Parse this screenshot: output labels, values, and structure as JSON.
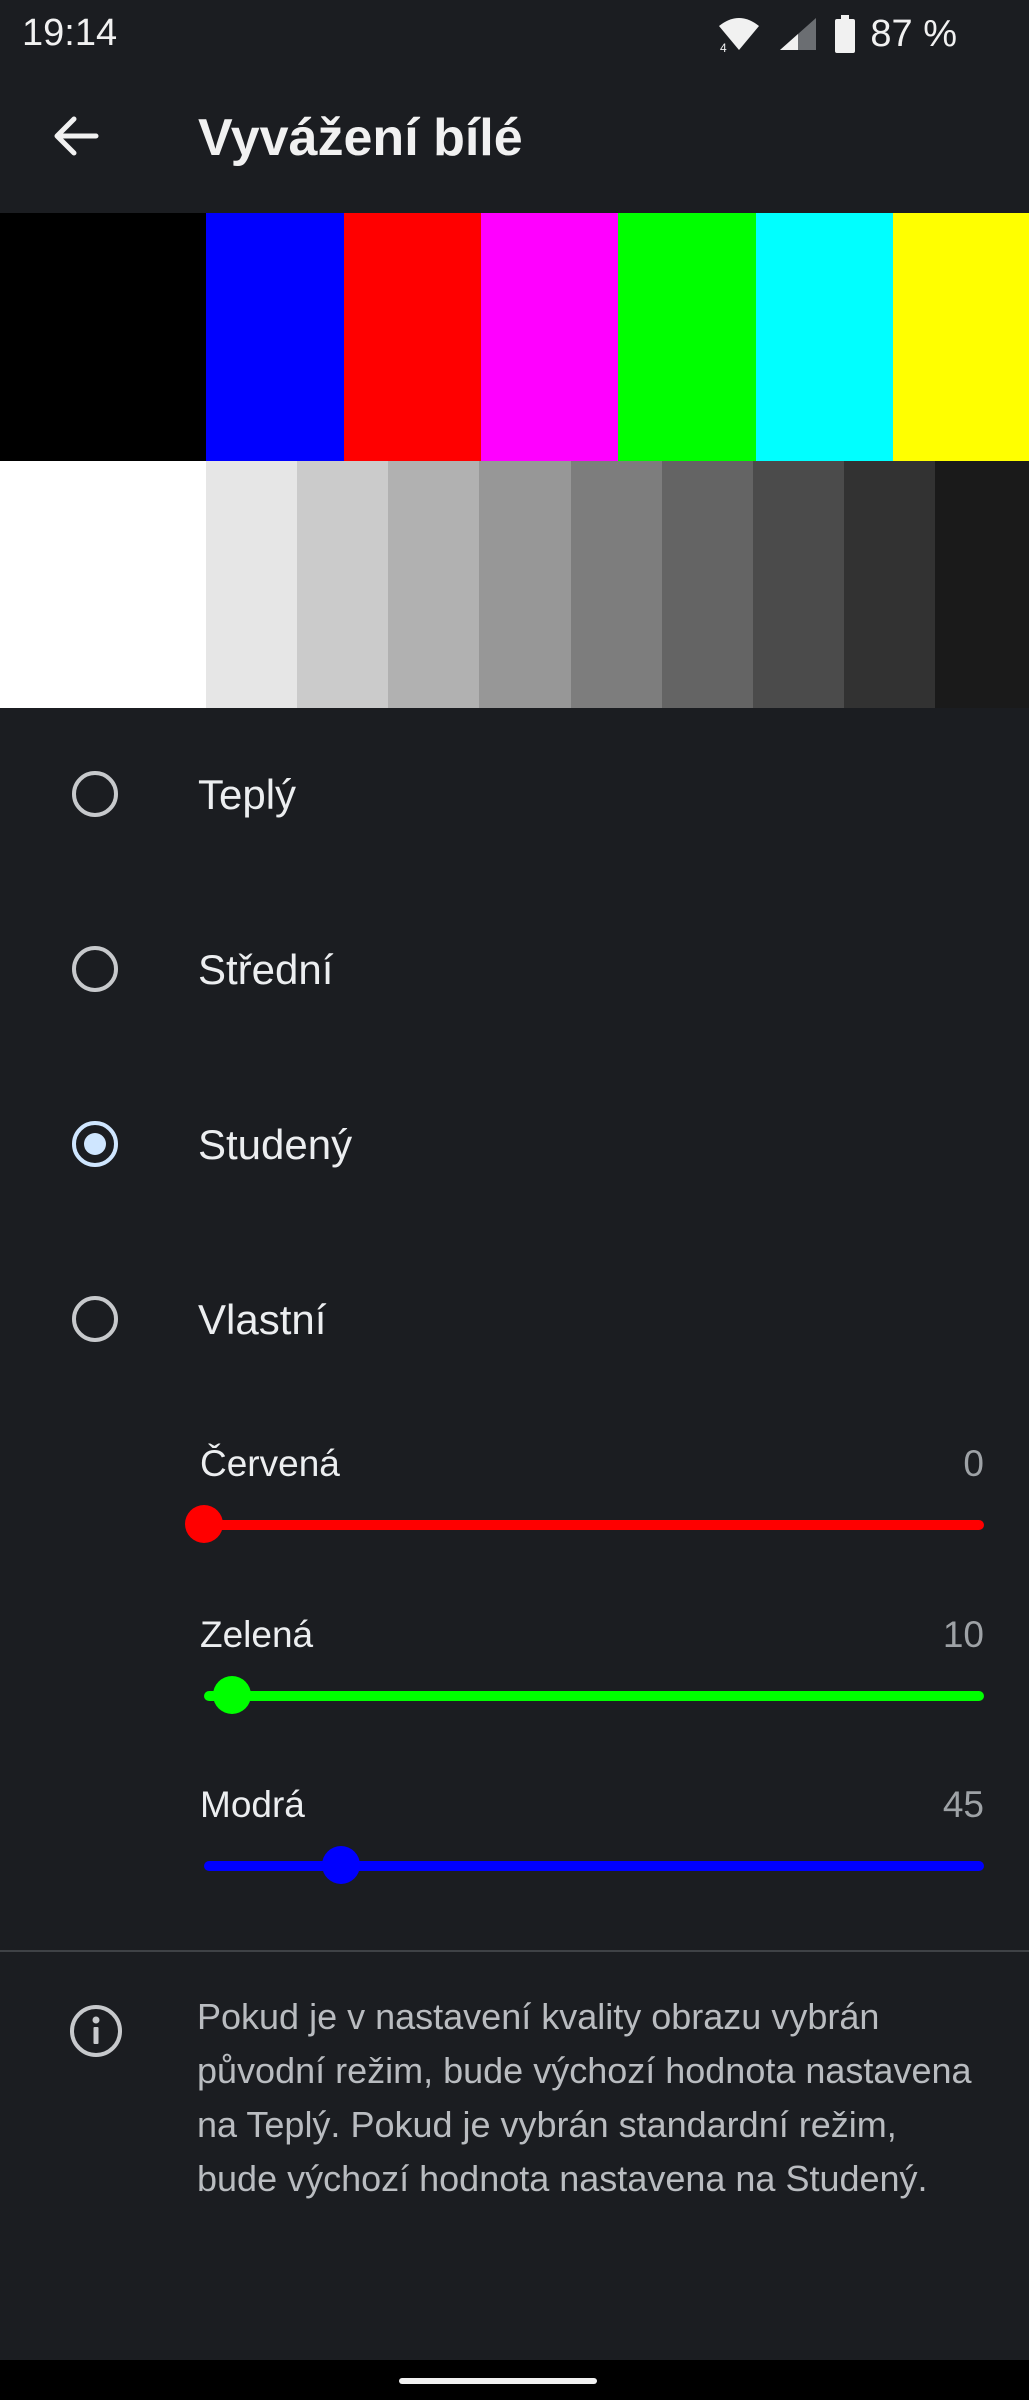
{
  "status_bar": {
    "time": "19:14",
    "battery": "87 %",
    "icons": [
      "wifi-icon",
      "signal-icon",
      "battery-icon"
    ]
  },
  "header": {
    "back_icon": "arrow-left-icon",
    "title": "Vyvážení bílé"
  },
  "color_bars": {
    "top": [
      "#000000",
      "#0000ff",
      "#ff0000",
      "#ff00ff",
      "#00ff00",
      "#00ffff",
      "#ffff00"
    ],
    "bottom": [
      "#ffffff",
      "#e6e6e6",
      "#cbcbcb",
      "#b1b1b1",
      "#979797",
      "#7d7d7d",
      "#646464",
      "#4b4b4b",
      "#323232",
      "#1a1a1a"
    ]
  },
  "options": [
    {
      "label": "Teplý",
      "selected": false
    },
    {
      "label": "Střední",
      "selected": false
    },
    {
      "label": "Studený",
      "selected": true
    },
    {
      "label": "Vlastní",
      "selected": false
    }
  ],
  "sliders": [
    {
      "label": "Červená",
      "value": "0",
      "fraction": 0.0,
      "color": "#ff0000"
    },
    {
      "label": "Zelená",
      "value": "10",
      "fraction": 0.036,
      "color": "#00ff00"
    },
    {
      "label": "Modrá",
      "value": "45",
      "fraction": 0.175,
      "color": "#0000ff"
    }
  ],
  "info": {
    "icon": "info-icon",
    "text": "Pokud je v nastavení kvality obrazu vybrán původní režim, bude výchozí hodnota nastavena na Teplý. Pokud je vybrán standardní režim, bude výchozí hodnota nastavena na Studený."
  }
}
